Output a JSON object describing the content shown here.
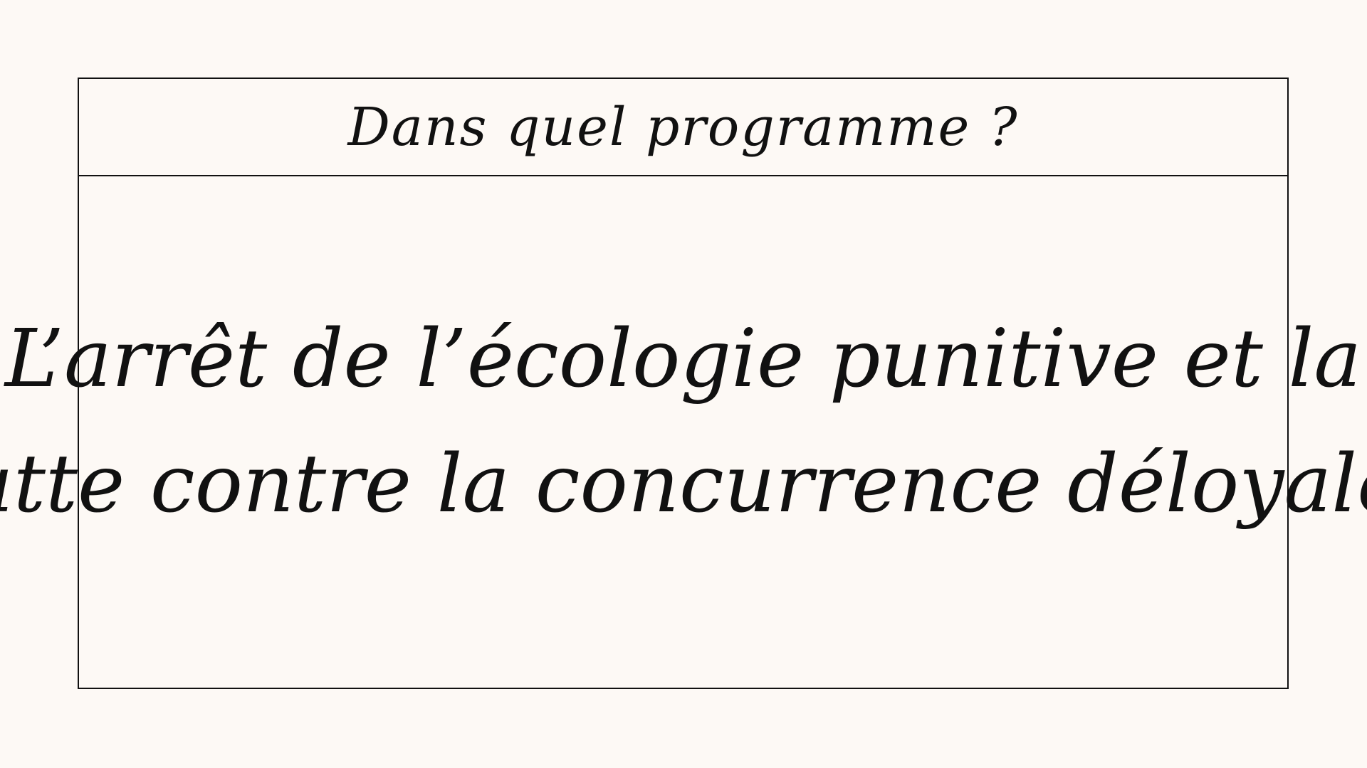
{
  "slide": {
    "question": "Dans quel programme ?",
    "statement_lines": [
      "L’arrêt de l’écologie punitive et la",
      "lutte contre la concurrence déloyale."
    ]
  },
  "colors": {
    "background": "#fdf9f5",
    "ink": "#111111"
  }
}
